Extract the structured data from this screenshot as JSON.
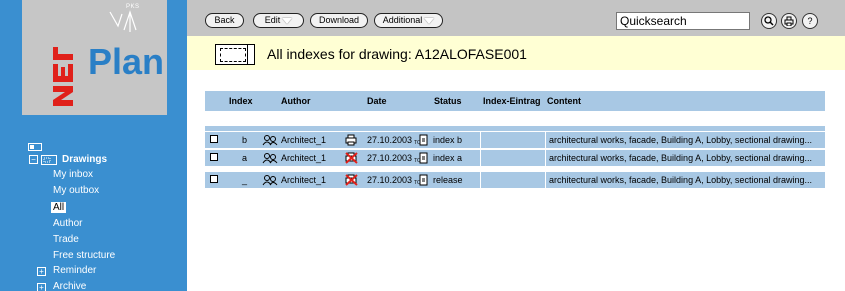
{
  "app": {
    "logo_text": "Plan",
    "logo_net": "NET",
    "logo_badge": "PKS"
  },
  "colors": {
    "sidebar": "#3a8fd0",
    "toolbar": "#c4c4c4",
    "title_bg": "#ffffd4",
    "table_bg": "#a8c8e4"
  },
  "toolbar": {
    "back_label": "Back",
    "edit_label": "Edit",
    "download_label": "Download",
    "additional_label": "Additional",
    "search_value": "Quicksearch",
    "icons": [
      "search-icon",
      "printer-icon",
      "help-icon"
    ]
  },
  "title": {
    "text": "All indexes for drawing: A12ALOFASE001"
  },
  "sidebar": {
    "drawings_label": "Drawings",
    "items": [
      {
        "label": "My inbox"
      },
      {
        "label": "My outbox"
      },
      {
        "label": "All"
      },
      {
        "label": "Author"
      },
      {
        "label": "Trade"
      },
      {
        "label": "Free structure"
      }
    ],
    "reminder_label": "Reminder",
    "archive_label": "Archive"
  },
  "table": {
    "headers": [
      "Index",
      "Author",
      "Date",
      "Status",
      "Index-Eintrag",
      "Content"
    ],
    "rows": [
      {
        "index": "b",
        "author": "Architect_1",
        "date": "27.10.2003",
        "status": "index b",
        "content": "architectural works, facade, Building A, Lobby, sectional drawing..."
      },
      {
        "index": "a",
        "author": "Architect_1",
        "date": "27.10.2003",
        "status": "index a",
        "content": "architectural works, facade, Building A, Lobby, sectional drawing..."
      },
      {
        "index": "_",
        "author": "Architect_1",
        "date": "27.10.2003",
        "status": "release",
        "content": "architectural works, facade, Building A, Lobby, sectional drawing..."
      }
    ]
  }
}
